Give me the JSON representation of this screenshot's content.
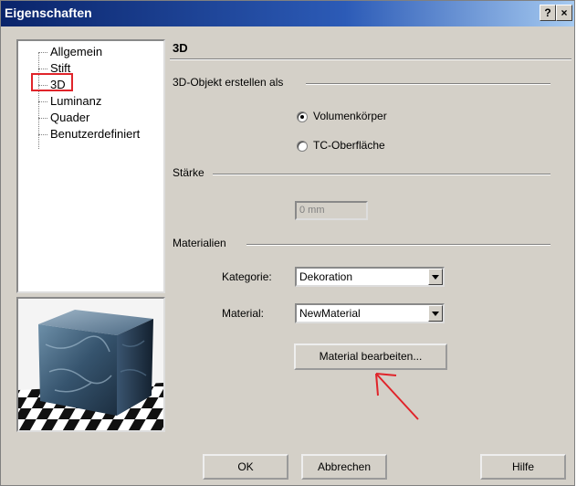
{
  "window": {
    "title": "Eigenschaften",
    "help_label": "?",
    "close_label": "×"
  },
  "tree": {
    "items": [
      {
        "label": "Allgemein"
      },
      {
        "label": "Stift"
      },
      {
        "label": "3D",
        "selected": true
      },
      {
        "label": "Luminanz"
      },
      {
        "label": "Quader"
      },
      {
        "label": "Benutzerdefiniert"
      }
    ]
  },
  "page": {
    "title": "3D",
    "create_as_label": "3D-Objekt erstellen als",
    "options": [
      {
        "label": "Volumenkörper",
        "checked": true
      },
      {
        "label": "TC-Oberfläche",
        "checked": false
      }
    ],
    "thickness_label": "Stärke",
    "thickness_value": "0 mm",
    "materials_label": "Materialien",
    "category_label": "Kategorie:",
    "category_value": "Dekoration",
    "material_label": "Material:",
    "material_value": "NewMaterial",
    "edit_material_label": "Material bearbeiten..."
  },
  "footer": {
    "ok_label": "OK",
    "cancel_label": "Abbrechen",
    "help_label": "Hilfe"
  },
  "colors": {
    "highlight_box": "#e0242a",
    "arrow": "#e0242a",
    "titlebar": "#0a246a"
  }
}
